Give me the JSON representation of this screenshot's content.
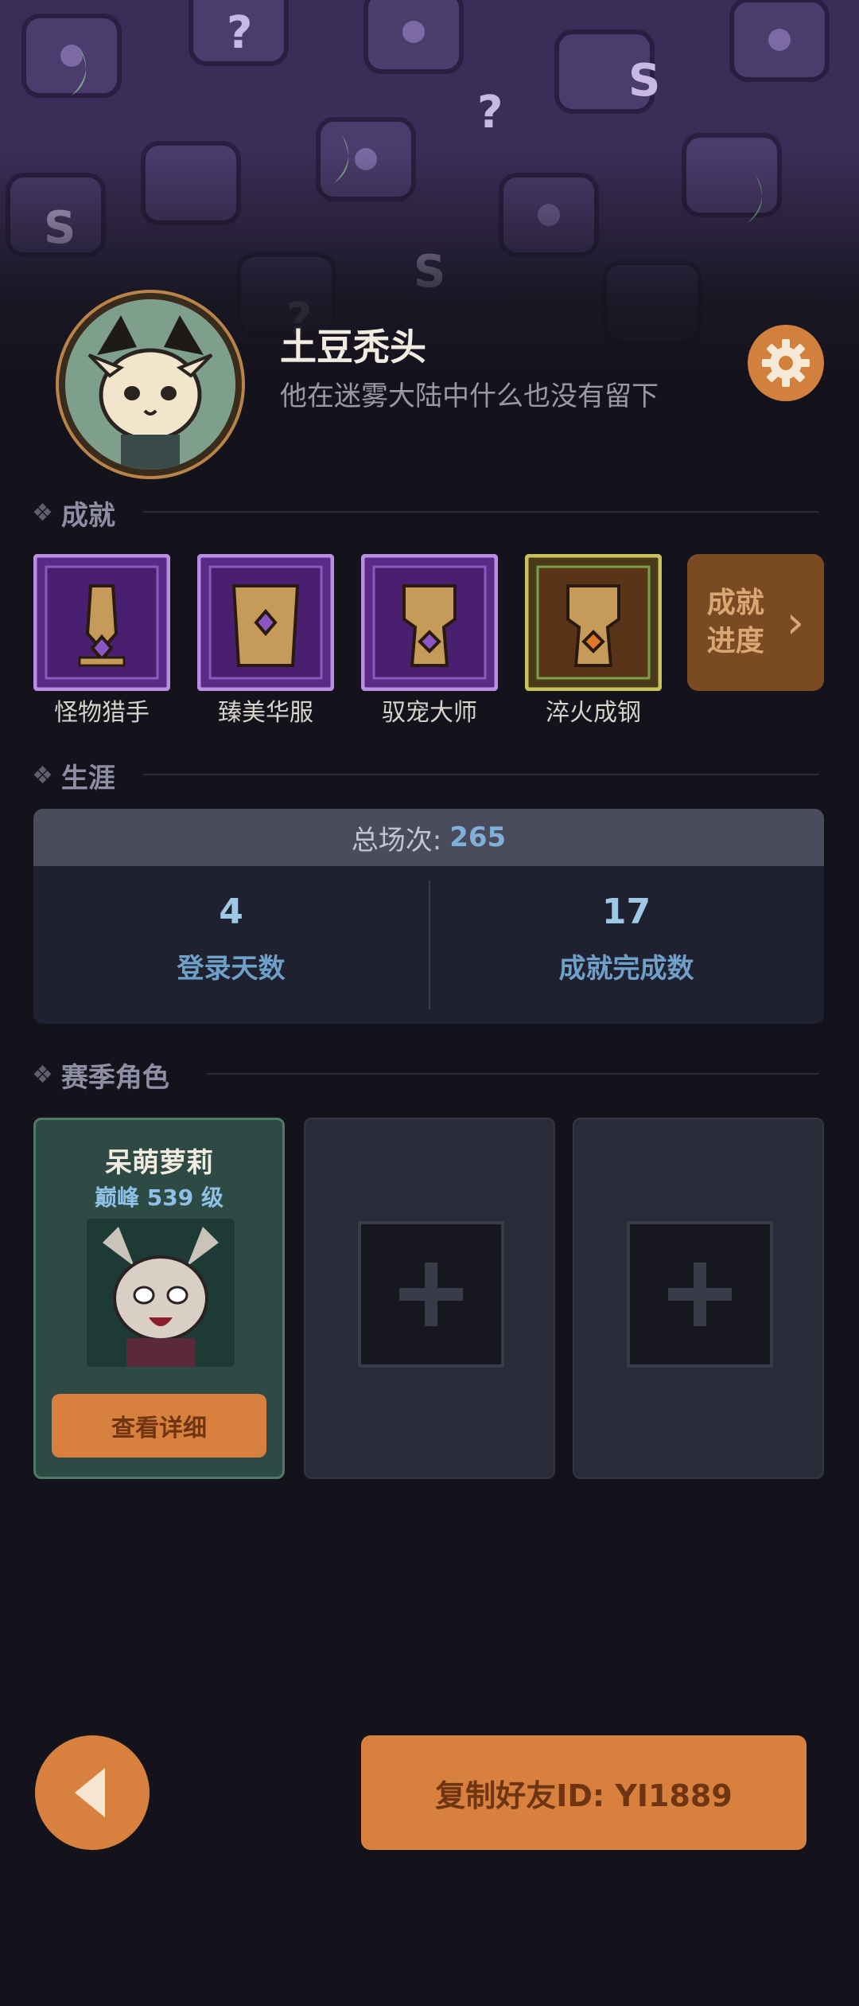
{
  "profile": {
    "name": "土豆秃头",
    "motto": "他在迷雾大陆中什么也没有留下"
  },
  "sections": {
    "achievements": "成就",
    "career": "生涯",
    "season_roles": "赛季角色"
  },
  "achievements": [
    {
      "label": "怪物猎手",
      "icon": "sword-shield-icon",
      "frame": "purple"
    },
    {
      "label": "臻美华服",
      "icon": "armor-icon",
      "frame": "purple"
    },
    {
      "label": "驭宠大师",
      "icon": "fist-icon",
      "frame": "purple"
    },
    {
      "label": "淬火成钢",
      "icon": "fist-icon",
      "frame": "gold"
    }
  ],
  "achievement_progress": {
    "label": "成就进度"
  },
  "career": {
    "total_label": "总场次:",
    "total_value": "265",
    "login_days_value": "4",
    "login_days_label": "登录天数",
    "achievements_done_value": "17",
    "achievements_done_label": "成就完成数"
  },
  "roles": [
    {
      "name": "呆萌萝莉",
      "level": "巅峰 539 级",
      "button": "查看详细"
    }
  ],
  "footer": {
    "copy_label": "复制好友ID: YI1889"
  },
  "colors": {
    "accent": "#d8813f",
    "banner": "#3a2d57",
    "background": "#14131c"
  }
}
